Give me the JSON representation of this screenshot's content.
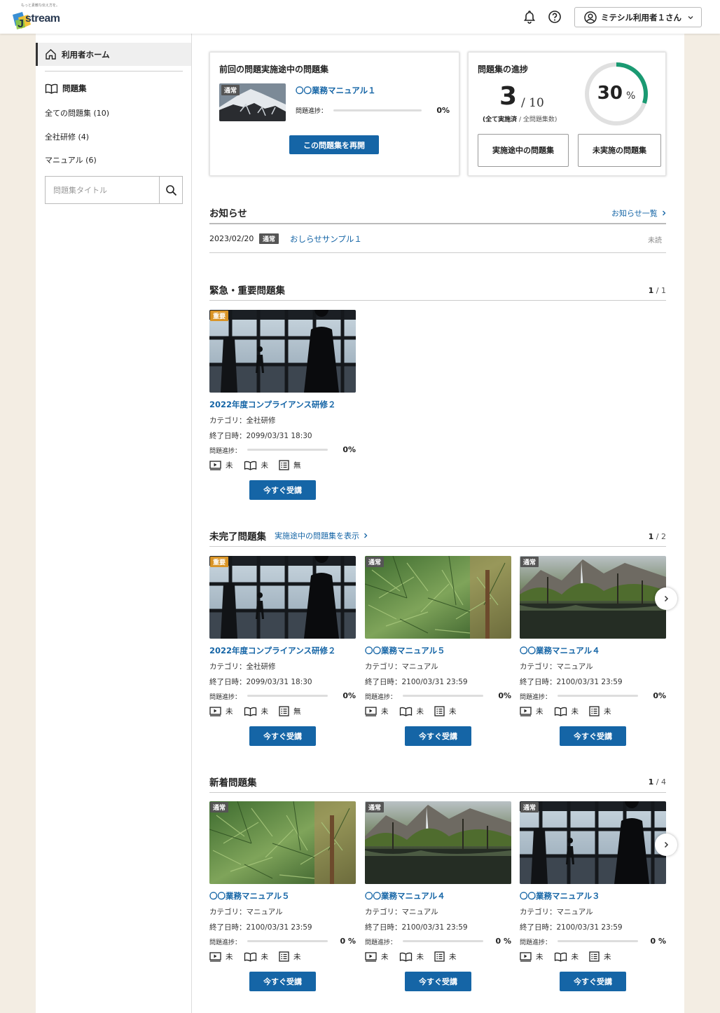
{
  "header": {
    "logo_tagline": "もっと素敵な伝え方を。",
    "logo_text": "stream",
    "logo_letter": "J",
    "user_name": "ミテシル利用者１さん",
    "icons": [
      "bell-icon",
      "help-icon",
      "user-circle-icon",
      "chevron-down-icon"
    ]
  },
  "sidebar": {
    "home_label": "利用者ホーム",
    "section_label": "問題集",
    "links": [
      {
        "label": "全ての問題集 (10)"
      },
      {
        "label": "全社研修 (4)"
      },
      {
        "label": "マニュアル (6)"
      }
    ],
    "search_placeholder": "問題集タイトル"
  },
  "resume": {
    "title": "前回の問題実施途中の問題集",
    "badge": "通常",
    "name": "〇〇業務マニュアル１",
    "progress_label": "問題進捗：",
    "progress_value": "0%",
    "progress": 0,
    "button": "この問題集を再開"
  },
  "stats": {
    "title": "問題集の進捗",
    "done": "3",
    "total": "/ 10",
    "caption_bold": "(全て実施済",
    "caption_rest": " / 全問題集数)",
    "percent": "30",
    "percent_unit": "%",
    "ratio": 0.3,
    "btn_inprogress": "実施途中の問題集",
    "btn_notstarted": "未実施の問題集",
    "accent": "#1a9a72"
  },
  "news": {
    "title": "お知らせ",
    "all_link": "お知らせ一覧",
    "item": {
      "date": "2023/02/20",
      "badge": "通常",
      "title": "おしらせサンプル１",
      "status": "未読"
    }
  },
  "labels": {
    "category": "カテゴリ：",
    "end_date": "終了日時：",
    "progress": "問題進捗：",
    "start": "今すぐ受講"
  },
  "urgent": {
    "title": "緊急・重要問題集",
    "page_current": "1",
    "page_total": " / 1",
    "cards": [
      {
        "badge": "重要",
        "title": "2022年度コンプライアンス研修２",
        "category": "全社研修",
        "end": "2099/03/31 18:30",
        "progress": "0%",
        "video": "未",
        "book": "未",
        "list": "無",
        "img": "office"
      }
    ]
  },
  "incomplete": {
    "title": "未完了問題集",
    "link": "実施途中の問題集を表示",
    "page_current": "1",
    "page_total": " / 2",
    "cards": [
      {
        "badge": "重要",
        "title": "2022年度コンプライアンス研修２",
        "category": "全社研修",
        "end": "2099/03/31 18:30",
        "progress": "0%",
        "video": "未",
        "book": "未",
        "list": "無",
        "img": "office"
      },
      {
        "badge": "通常",
        "title": "〇〇業務マニュアル５",
        "category": "マニュアル",
        "end": "2100/03/31 23:59",
        "progress": "0%",
        "video": "未",
        "book": "未",
        "list": "未",
        "img": "pine"
      },
      {
        "badge": "通常",
        "title": "〇〇業務マニュアル４",
        "category": "マニュアル",
        "end": "2100/03/31 23:59",
        "progress": "0%",
        "video": "未",
        "book": "未",
        "list": "未",
        "img": "valley"
      }
    ]
  },
  "newest": {
    "title": "新着問題集",
    "page_current": "1",
    "page_total": " / 4",
    "cards": [
      {
        "badge": "通常",
        "title": "〇〇業務マニュアル５",
        "category": "マニュアル",
        "end": "2100/03/31 23:59",
        "progress": "0 %",
        "video": "未",
        "book": "未",
        "list": "未",
        "img": "pine"
      },
      {
        "badge": "通常",
        "title": "〇〇業務マニュアル４",
        "category": "マニュアル",
        "end": "2100/03/31 23:59",
        "progress": "0 %",
        "video": "未",
        "book": "未",
        "list": "未",
        "img": "valley"
      },
      {
        "badge": "通常",
        "title": "〇〇業務マニュアル３",
        "category": "マニュアル",
        "end": "2100/03/31 23:59",
        "progress": "0 %",
        "video": "未",
        "book": "未",
        "list": "未",
        "img": "office"
      }
    ]
  }
}
